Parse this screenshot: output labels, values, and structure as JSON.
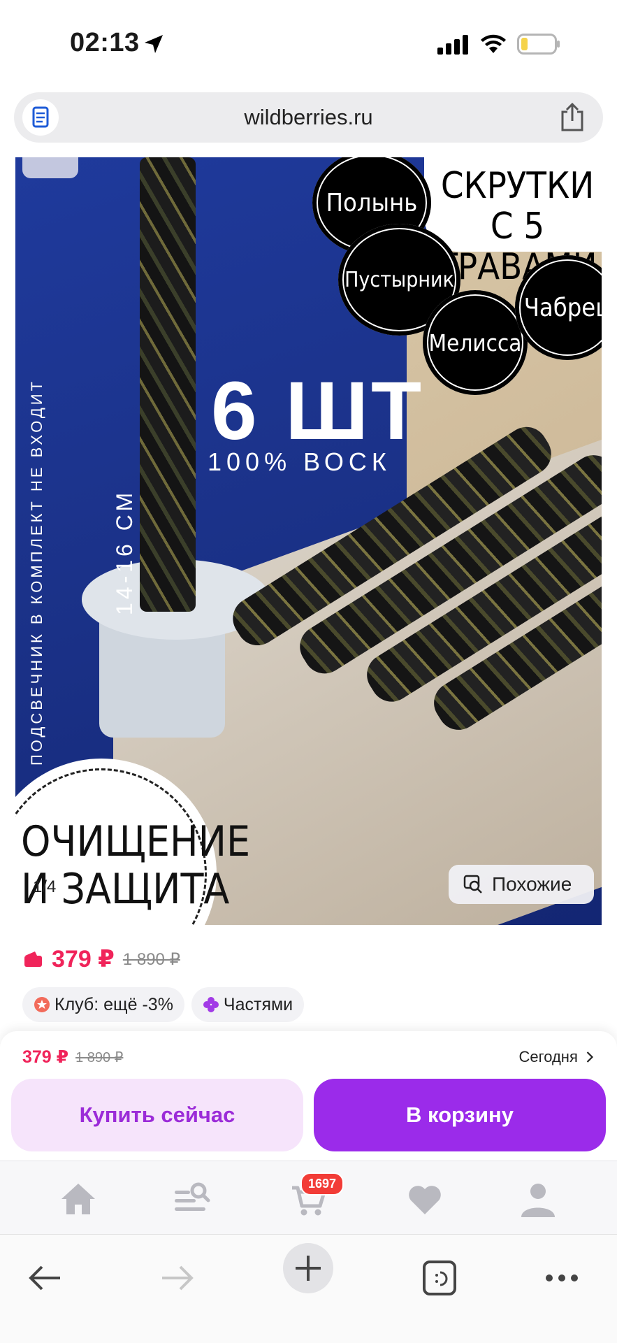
{
  "status_bar": {
    "time": "02:13"
  },
  "browser": {
    "url": "wildberries.ru"
  },
  "product_image": {
    "bubbles": [
      "Полынь",
      "Пустырник",
      "Мелисса",
      "Чабрец"
    ],
    "title_lines": [
      "СКРУТКИ С 5",
      "ТРАВАМИ"
    ],
    "count": "6 ШТ",
    "material": "100% ВОСК",
    "size": "14-16 СМ",
    "note": "ПОДСВЕЧНИК В КОМПЛЕКТ НЕ ВХОДИТ",
    "corner_lines": [
      "ОЧИЩЕНИЕ",
      "И ЗАЩИТА"
    ],
    "counter": "1/4",
    "similar_label": "Похожие"
  },
  "price": {
    "current": "379 ₽",
    "old": "1 890 ₽"
  },
  "chips": [
    {
      "icon": "star-badge-icon",
      "label": "Клуб: ещё -3%"
    },
    {
      "icon": "clover-icon",
      "label": "Частями"
    }
  ],
  "buy_panel": {
    "price": "379 ₽",
    "old_price": "1 890 ₽",
    "delivery": "Сегодня",
    "buy_now": "Купить сейчас",
    "add_to_cart": "В корзину"
  },
  "tab_bar": {
    "items": [
      "home-icon",
      "catalog-search-icon",
      "cart-icon",
      "heart-icon",
      "profile-icon"
    ],
    "cart_badge": "1697"
  },
  "colors": {
    "accent": "#9b2bea",
    "price": "#f0245a",
    "badge": "#f23c37"
  }
}
